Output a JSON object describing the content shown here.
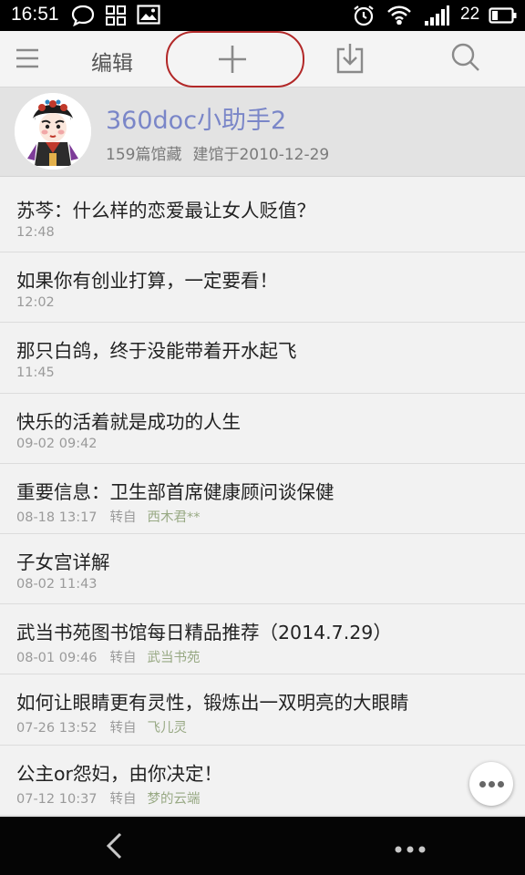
{
  "status_bar": {
    "time": "16:51",
    "battery_level": "22",
    "icons": [
      "chat-bubble-icon",
      "app-grid-icon",
      "image-icon",
      "alarm-icon",
      "wifi-icon",
      "signal-icon",
      "battery-icon"
    ]
  },
  "toolbar": {
    "edit_label": "编辑",
    "icons": [
      "menu-icon",
      "add-icon",
      "download-icon",
      "search-icon"
    ],
    "highlight_color": "#b22828"
  },
  "profile": {
    "name": "360doc小助手2",
    "article_count": "159篇馆藏",
    "established": "建馆于2010-12-29",
    "name_color": "#7a86c8"
  },
  "articles": [
    {
      "title": "苏芩：什么样的恋爱最让女人贬值？",
      "time": "12:48",
      "via": "",
      "source": ""
    },
    {
      "title": "如果你有创业打算，一定要看！",
      "time": "12:02",
      "via": "",
      "source": ""
    },
    {
      "title": "那只白鸽，终于没能带着开水起飞",
      "time": "11:45",
      "via": "",
      "source": ""
    },
    {
      "title": "快乐的活着就是成功的人生",
      "time": "09-02 09:42",
      "via": "",
      "source": ""
    },
    {
      "title": "重要信息：卫生部首席健康顾问谈保健",
      "time": "08-18 13:17",
      "via": "转自",
      "source": "西木君**"
    },
    {
      "title": "子女宫详解",
      "time": "08-02 11:43",
      "via": "",
      "source": ""
    },
    {
      "title": "武当书苑图书馆每日精品推荐（2014.7.29）",
      "time": "08-01 09:46",
      "via": "转自",
      "source": "武当书苑"
    },
    {
      "title": "如何让眼睛更有灵性，锻炼出一双明亮的大眼睛",
      "time": "07-26 13:52",
      "via": "转自",
      "source": "飞儿灵"
    },
    {
      "title": "公主or怨妇，由你决定！",
      "time": "07-12 10:37",
      "via": "转自",
      "source": "梦的云端"
    }
  ],
  "nav": {
    "icons": [
      "back-icon",
      "more-icon"
    ]
  },
  "fab": {
    "icon": "more-horizontal-icon"
  }
}
